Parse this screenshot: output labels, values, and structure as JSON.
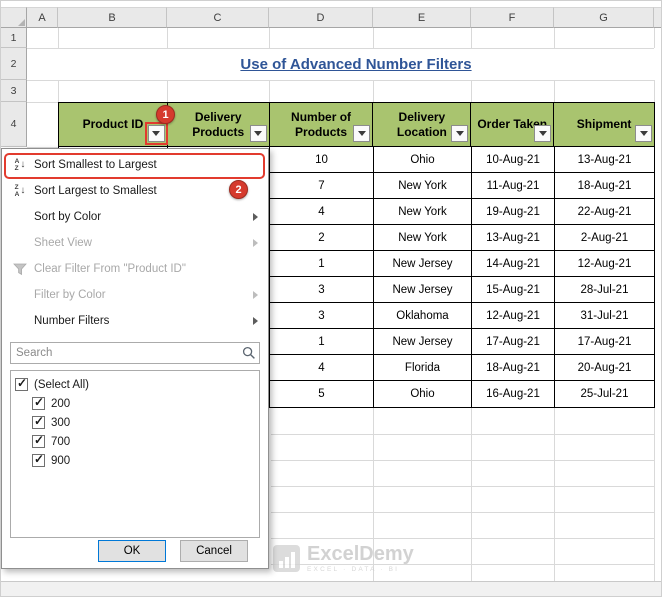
{
  "spreadsheet": {
    "column_headers": [
      "A",
      "B",
      "C",
      "D",
      "E",
      "F",
      "G"
    ],
    "row_headers": [
      "1",
      "2",
      "3",
      "4"
    ]
  },
  "title": "Use of Advanced Number Filters",
  "table": {
    "columns": [
      "Product ID",
      "Delivery Products",
      "Number of Products",
      "Delivery Location",
      "Order Taken",
      "Shipment"
    ],
    "rows": [
      [
        "10",
        "Ohio",
        "10-Aug-21",
        "13-Aug-21"
      ],
      [
        "7",
        "New York",
        "11-Aug-21",
        "18-Aug-21"
      ],
      [
        "4",
        "New York",
        "19-Aug-21",
        "22-Aug-21"
      ],
      [
        "2",
        "New York",
        "13-Aug-21",
        "2-Aug-21"
      ],
      [
        "1",
        "New Jersey",
        "14-Aug-21",
        "12-Aug-21"
      ],
      [
        "3",
        "New Jersey",
        "15-Aug-21",
        "28-Jul-21"
      ],
      [
        "3",
        "Oklahoma",
        "12-Aug-21",
        "31-Jul-21"
      ],
      [
        "1",
        "New Jersey",
        "17-Aug-21",
        "17-Aug-21"
      ],
      [
        "4",
        "Florida",
        "18-Aug-21",
        "20-Aug-21"
      ],
      [
        "5",
        "Ohio",
        "16-Aug-21",
        "25-Jul-21"
      ]
    ]
  },
  "filter_menu": {
    "sort_smallest": "Sort Smallest to Largest",
    "sort_largest": "Sort Largest to Smallest",
    "sort_by_color": "Sort by Color",
    "sheet_view": "Sheet View",
    "clear_filter": "Clear Filter From \"Product ID\"",
    "filter_by_color": "Filter by Color",
    "number_filters": "Number Filters",
    "search_placeholder": "Search",
    "checkbox_items": [
      {
        "label": "(Select All)",
        "checked": true,
        "child": false
      },
      {
        "label": "200",
        "checked": true,
        "child": true
      },
      {
        "label": "300",
        "checked": true,
        "child": true
      },
      {
        "label": "700",
        "checked": true,
        "child": true
      },
      {
        "label": "900",
        "checked": true,
        "child": true
      }
    ],
    "ok_label": "OK",
    "cancel_label": "Cancel"
  },
  "annotations": {
    "step1": "1",
    "step2": "2"
  },
  "watermark": {
    "name": "ExcelDemy",
    "tagline": "EXCEL · DATA · BI"
  },
  "icons": {
    "sort_letter_a": "A",
    "sort_letter_z": "Z",
    "arrow_down": "↓",
    "check": "✓"
  },
  "colors": {
    "header_fill": "#a9c46f",
    "title_blue": "#2f5597",
    "annotation_red": "#e23b2e",
    "badge_red": "#d53a2d"
  }
}
